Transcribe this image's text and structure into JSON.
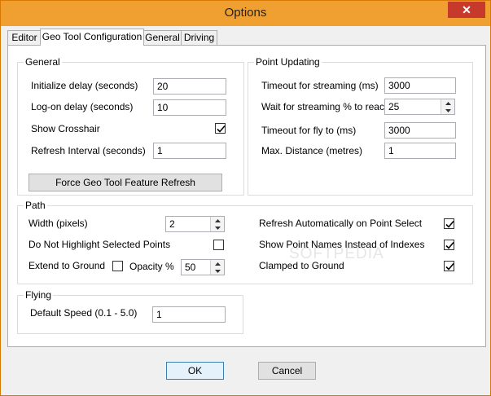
{
  "window": {
    "title": "Options",
    "close_glyph": "✕"
  },
  "tabs": [
    {
      "label": "Editor"
    },
    {
      "label": "Geo Tool Configuration"
    },
    {
      "label": "General"
    },
    {
      "label": "Driving"
    }
  ],
  "general": {
    "legend": "General",
    "initialize_delay": {
      "label": "Initialize delay (seconds)",
      "value": "20"
    },
    "logon_delay": {
      "label": "Log-on delay (seconds)",
      "value": "10"
    },
    "show_crosshair": {
      "label": "Show Crosshair",
      "checked": true
    },
    "refresh_interval": {
      "label": "Refresh Interval (seconds)",
      "value": "1"
    },
    "force_refresh_button": "Force Geo Tool Feature Refresh"
  },
  "point_updating": {
    "legend": "Point Updating",
    "timeout_streaming": {
      "label": "Timeout for streaming (ms)",
      "value": "3000"
    },
    "wait_streaming": {
      "label": "Wait for streaming % to reach",
      "value": "25"
    },
    "timeout_fly": {
      "label": "Timeout for fly to (ms)",
      "value": "3000"
    },
    "max_distance": {
      "label": "Max. Distance (metres)",
      "value": "1"
    }
  },
  "path": {
    "legend": "Path",
    "width": {
      "label": "Width (pixels)",
      "value": "2"
    },
    "do_not_highlight": {
      "label": "Do Not Highlight Selected Points",
      "checked": false
    },
    "extend_to_ground": {
      "label": "Extend to Ground",
      "checked": false
    },
    "opacity": {
      "label": "Opacity %",
      "value": "50"
    },
    "refresh_on_select": {
      "label": "Refresh Automatically on Point Select",
      "checked": true
    },
    "show_point_names": {
      "label": "Show Point Names Instead of Indexes",
      "checked": true
    },
    "clamped_to_ground": {
      "label": "Clamped to Ground",
      "checked": true
    }
  },
  "flying": {
    "legend": "Flying",
    "default_speed": {
      "label": "Default Speed (0.1 - 5.0)",
      "value": "1"
    }
  },
  "footer": {
    "ok": "OK",
    "cancel": "Cancel"
  },
  "watermark": "SOFTPEDIA"
}
